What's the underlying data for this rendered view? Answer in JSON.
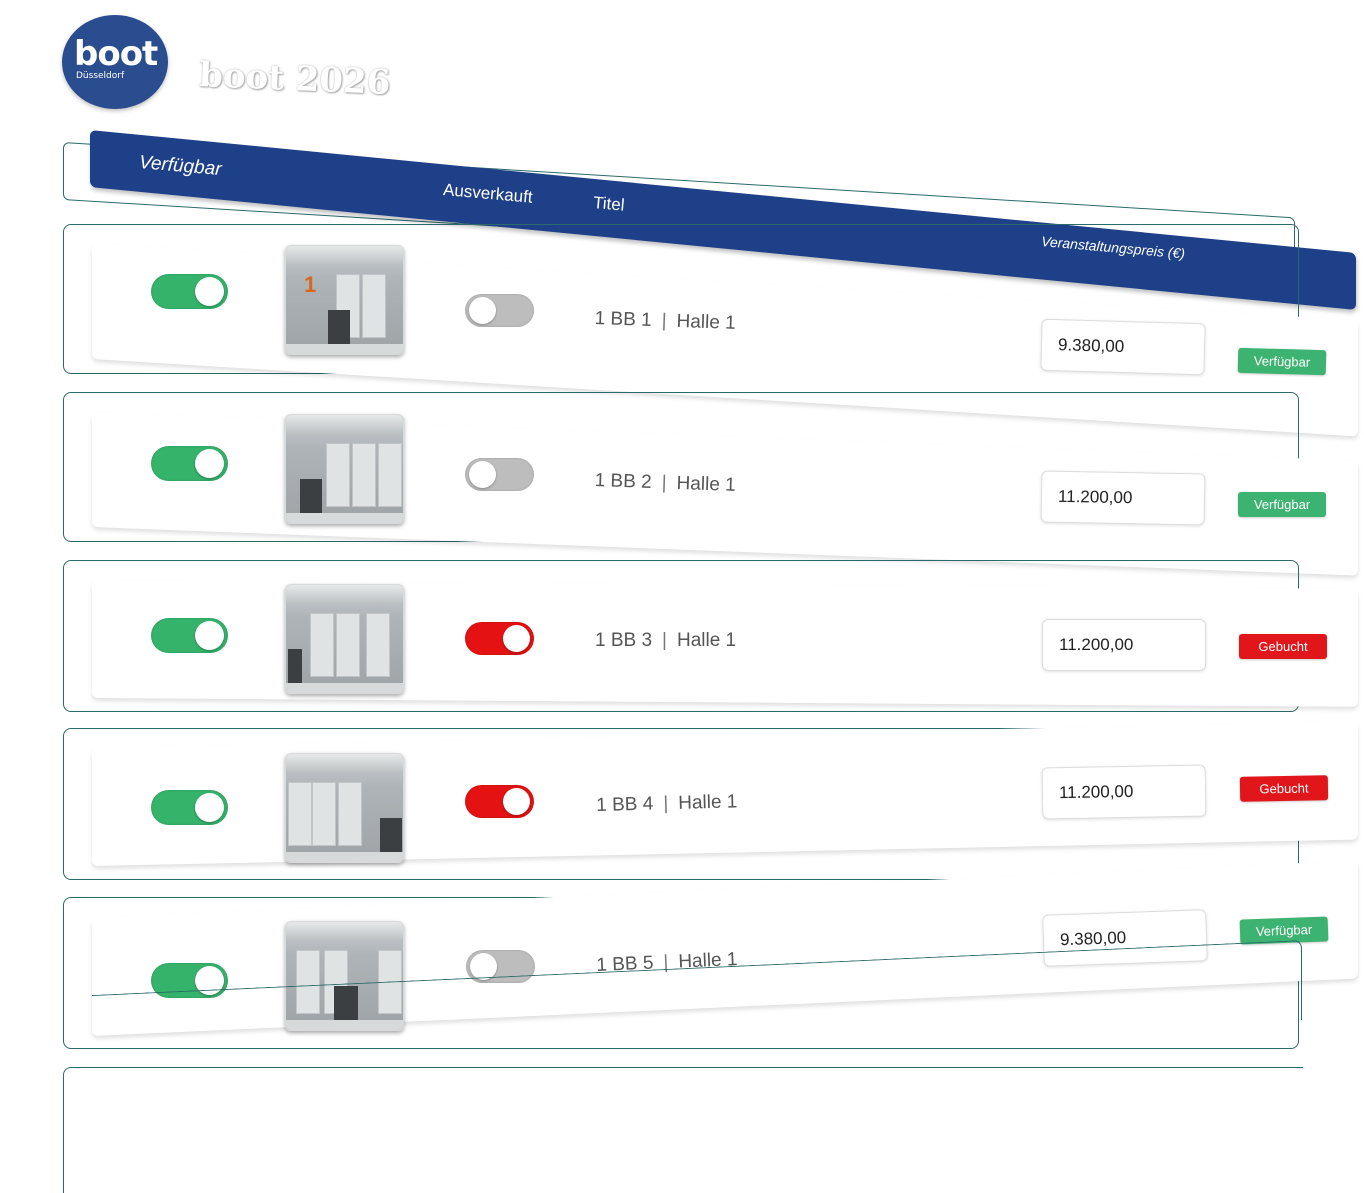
{
  "app": {
    "logo_word": "boot",
    "logo_sub": "Düsseldorf",
    "title": "boot 2026"
  },
  "table": {
    "headers": {
      "available": "Verfügbar",
      "sold_out": "Ausverkauft",
      "title": "Titel",
      "price": "Veranstaltungspreis (€)"
    },
    "rows": [
      {
        "title": "1 BB 1",
        "hall": "Halle 1",
        "price": "9.380,00",
        "available_on": true,
        "sold_out_on": false,
        "status": "Verfügbar"
      },
      {
        "title": "1 BB 2",
        "hall": "Halle 1",
        "price": "11.200,00",
        "available_on": true,
        "sold_out_on": false,
        "status": "Verfügbar"
      },
      {
        "title": "1 BB 3",
        "hall": "Halle 1",
        "price": "11.200,00",
        "available_on": true,
        "sold_out_on": true,
        "status": "Gebucht"
      },
      {
        "title": "1 BB 4",
        "hall": "Halle 1",
        "price": "11.200,00",
        "available_on": true,
        "sold_out_on": true,
        "status": "Gebucht"
      },
      {
        "title": "1 BB 5",
        "hall": "Halle 1",
        "price": "9.380,00",
        "available_on": true,
        "sold_out_on": false,
        "status": "Verfügbar"
      }
    ],
    "separator": "|"
  },
  "thumb_label": "1",
  "colors": {
    "header_blue": "#1e4088",
    "toggle_green": "#35b36b",
    "toggle_red": "#e41212",
    "toggle_gray": "#bdbdbd",
    "badge_green": "#3cb371",
    "badge_red": "#e0161a"
  }
}
